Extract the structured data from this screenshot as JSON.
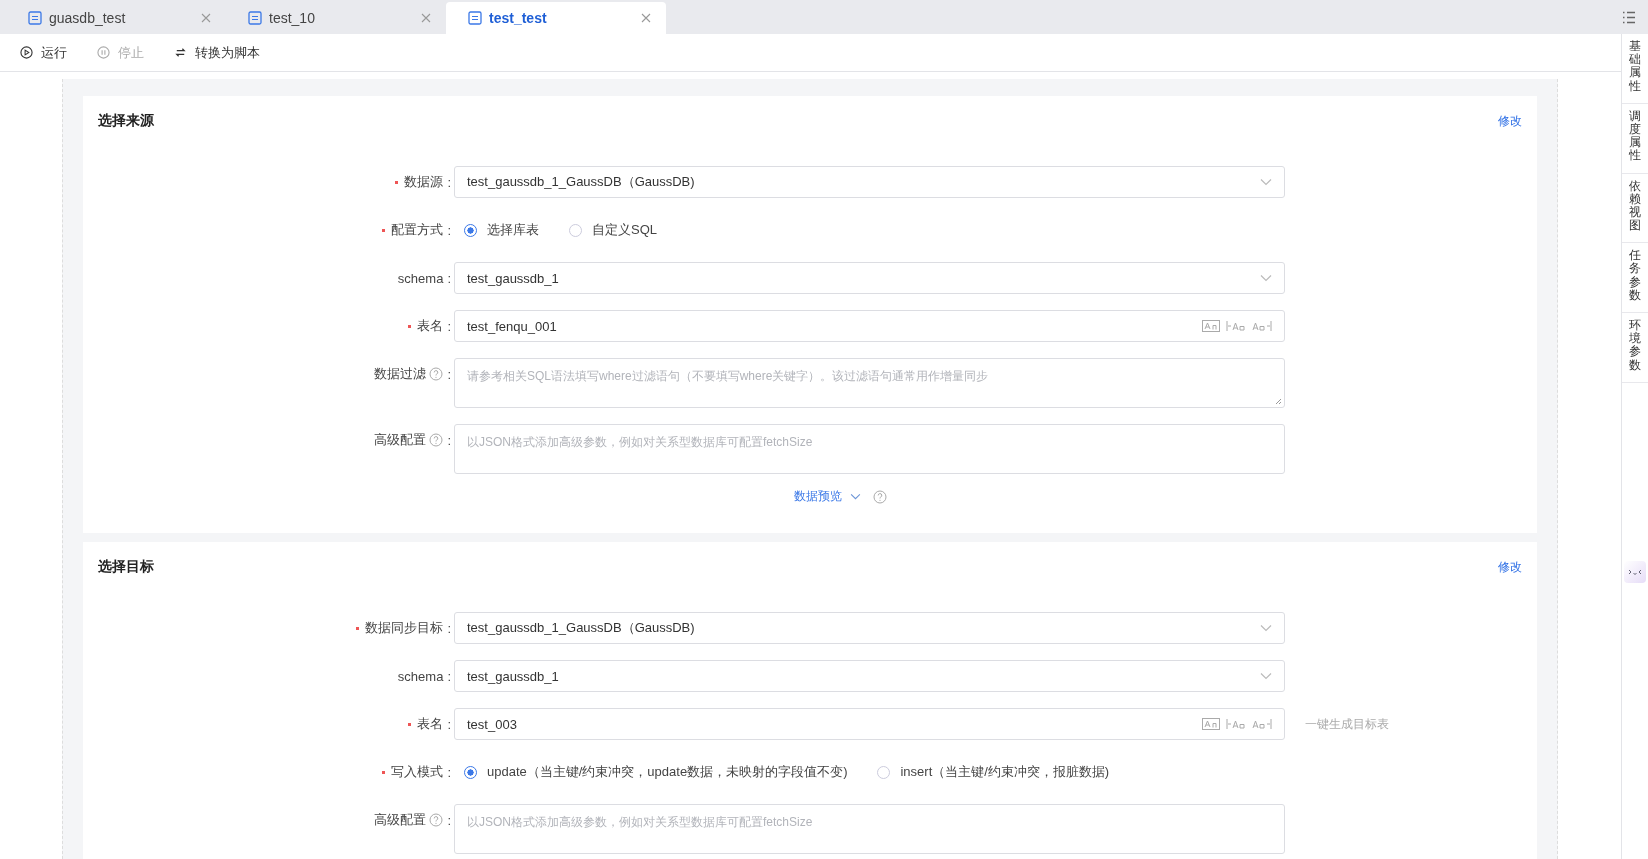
{
  "tabs": [
    {
      "label": "guasdb_test",
      "selected": false
    },
    {
      "label": "test_10",
      "selected": false
    },
    {
      "label": "test_test",
      "selected": true
    }
  ],
  "toolbar": [
    {
      "kind": "run",
      "label": "运行",
      "disabled": false
    },
    {
      "kind": "stop",
      "label": "停止",
      "disabled": true
    },
    {
      "kind": "convert",
      "label": "转换为脚本",
      "disabled": false
    }
  ],
  "side_panel": [
    {
      "label": "基础属性"
    },
    {
      "label": "调度属性"
    },
    {
      "label": "依赖视图"
    },
    {
      "label": "任务参数"
    },
    {
      "label": "环境参数"
    }
  ],
  "sections": [
    {
      "title": "选择来源",
      "edit_link": "修改",
      "fields": [
        {
          "kind": "select",
          "label": "数据源",
          "colon": ":",
          "required": true,
          "help": false,
          "value": "test_gaussdb_1_GaussDB（GaussDB)"
        },
        {
          "kind": "radio",
          "label": "配置方式",
          "colon": ":",
          "required": true,
          "help": false,
          "options": [
            {
              "label": "选择库表",
              "selected": true
            },
            {
              "label": "自定义SQL",
              "selected": false
            }
          ]
        },
        {
          "kind": "select",
          "label": "schema",
          "colon": ":",
          "required": false,
          "help": false,
          "value": "test_gaussdb_1"
        },
        {
          "kind": "input",
          "label": "表名",
          "colon": ":",
          "required": true,
          "help": false,
          "value": "test_fenqu_001"
        },
        {
          "kind": "textarea",
          "label": "数据过滤",
          "colon": ":",
          "required": false,
          "help": true,
          "resizable": true,
          "placeholder": "请参考相关SQL语法填写where过滤语句（不要填写where关键字）。该过滤语句通常用作增量同步"
        },
        {
          "kind": "textarea",
          "label": "高级配置",
          "colon": ":",
          "required": false,
          "help": true,
          "resizable": false,
          "placeholder": "以JSON格式添加高级参数，例如对关系型数据库可配置fetchSize"
        }
      ],
      "footer_link": "数据预览"
    },
    {
      "title": "选择目标",
      "edit_link": "修改",
      "fields": [
        {
          "kind": "select",
          "label": "数据同步目标",
          "colon": ":",
          "required": true,
          "help": false,
          "value": "test_gaussdb_1_GaussDB（GaussDB)"
        },
        {
          "kind": "select",
          "label": "schema",
          "colon": ":",
          "required": false,
          "help": false,
          "value": "test_gaussdb_1"
        },
        {
          "kind": "input",
          "label": "表名",
          "colon": ":",
          "required": true,
          "help": false,
          "value": "test_003",
          "extra_link": "一键生成目标表"
        },
        {
          "kind": "radio",
          "label": "写入模式",
          "colon": ":",
          "required": true,
          "help": false,
          "options": [
            {
              "label": "update（当主键/约束冲突，update数据，未映射的字段值不变)",
              "selected": true
            },
            {
              "label": "insert（当主键/约束冲突，报脏数据)",
              "selected": false
            }
          ]
        },
        {
          "kind": "textarea",
          "label": "高级配置",
          "colon": ":",
          "required": false,
          "help": true,
          "resizable": false,
          "placeholder": "以JSON格式添加高级参数，例如对关系型数据库可配置fetchSize"
        }
      ]
    }
  ]
}
